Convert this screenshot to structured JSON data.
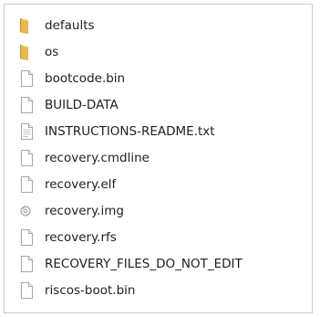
{
  "files": [
    {
      "name": "defaults",
      "icon": "folder-icon"
    },
    {
      "name": "os",
      "icon": "folder-icon"
    },
    {
      "name": "bootcode.bin",
      "icon": "file-icon"
    },
    {
      "name": "BUILD-DATA",
      "icon": "file-icon"
    },
    {
      "name": "INSTRUCTIONS-README.txt",
      "icon": "text-file-icon"
    },
    {
      "name": "recovery.cmdline",
      "icon": "file-icon"
    },
    {
      "name": "recovery.elf",
      "icon": "file-icon"
    },
    {
      "name": "recovery.img",
      "icon": "disc-image-icon"
    },
    {
      "name": "recovery.rfs",
      "icon": "file-icon"
    },
    {
      "name": "RECOVERY_FILES_DO_NOT_EDIT",
      "icon": "file-icon"
    },
    {
      "name": "riscos-boot.bin",
      "icon": "file-icon"
    }
  ],
  "colors": {
    "folder": "#e8b84a",
    "folder_dark": "#c9962a",
    "file_border": "#a7a7a7",
    "text": "#1e1e1e"
  }
}
